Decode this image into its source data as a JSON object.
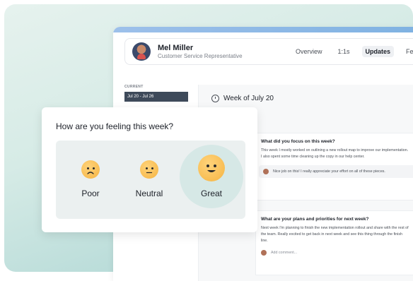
{
  "header": {
    "name": "Mel Miller",
    "role": "Customer Service Representative",
    "tabs": [
      "Overview",
      "1:1s",
      "Updates",
      "Feedback"
    ],
    "active_tab": "Updates"
  },
  "sidebar": {
    "label": "CURRENT",
    "item": "Jul 20 - Jul 26"
  },
  "main": {
    "week_title": "Week of July 20",
    "q1": {
      "title": "What did you focus on this week?",
      "text": "This week I mostly worked on outlining a new rollout map to improve our implementation. I also spent some time cleaning up the copy in our help center.",
      "comment": "Nice job on this! I really appreciate your effort on all of these pieces."
    },
    "q2": {
      "title": "What are your plans and priorities for next week?",
      "text": "Next week I'm planning to finish the new implementation rollout and share with the rest of the team. Really excited to get back in next week and see this thing through the finish line.",
      "add_comment": "Add comment..."
    }
  },
  "mood_card": {
    "title": "How are you feeling this week?",
    "options": [
      "Poor",
      "Neutral",
      "Great"
    ],
    "selected": "Great"
  },
  "colors": {
    "accent_bar": "#7fb2e2",
    "selected_mood_bg": "#d6e8e6",
    "face_yellow": "#f5b443"
  }
}
